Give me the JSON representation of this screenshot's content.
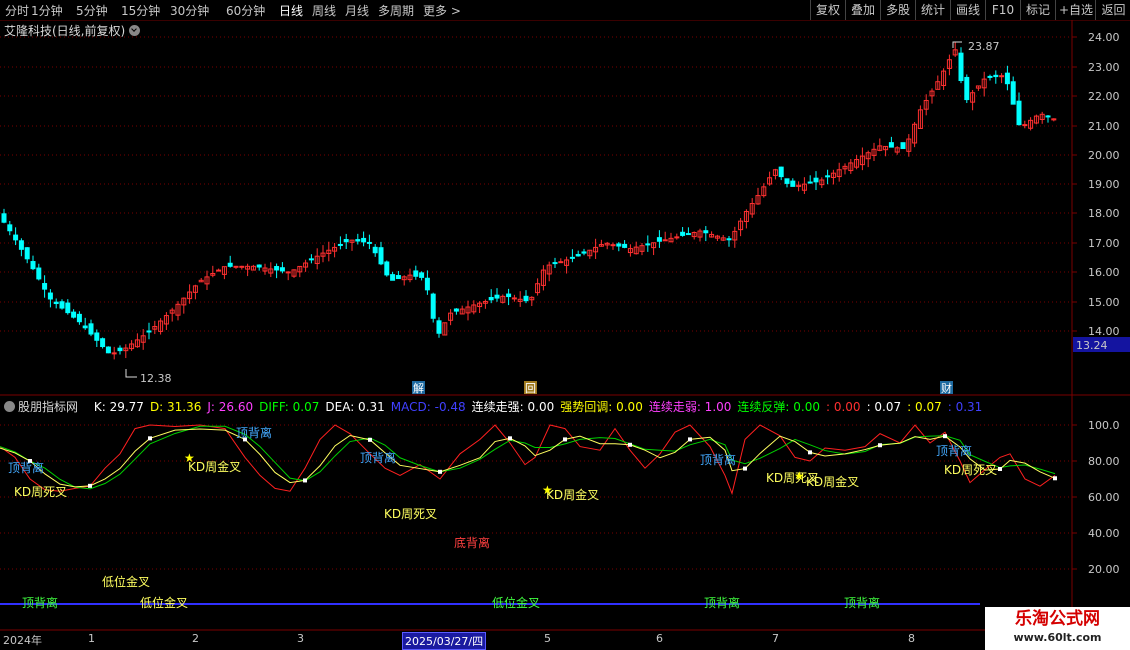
{
  "toolbar": {
    "periods": [
      "分时",
      "1分钟",
      "5分钟",
      "15分钟",
      "30分钟",
      "60分钟",
      "日线",
      "周线",
      "月线",
      "多周期",
      "更多 >"
    ],
    "active_period": "日线",
    "right_buttons": [
      "复权",
      "叠加",
      "多股",
      "统计",
      "画线",
      "F10",
      "标记",
      "+自选",
      "返回"
    ]
  },
  "stock": {
    "title": "艾隆科技(日线,前复权)"
  },
  "price_axis": {
    "ticks": [
      "24.00",
      "23.00",
      "22.00",
      "21.00",
      "20.00",
      "19.00",
      "18.00",
      "17.00",
      "16.00",
      "15.00",
      "14.00",
      "13.24"
    ],
    "current": "13.24"
  },
  "annotations": {
    "high": "23.87",
    "low": "12.38"
  },
  "markers": [
    "解",
    "回",
    "财"
  ],
  "indicator": {
    "name": "股朋指标网",
    "values": [
      {
        "label": "K: 29.77",
        "color": "#ffffff"
      },
      {
        "label": "D: 31.36",
        "color": "#ffff00"
      },
      {
        "label": "J: 26.60",
        "color": "#ff40ff"
      },
      {
        "label": "DIFF: 0.07",
        "color": "#00ff00"
      },
      {
        "label": "DEA: 0.31",
        "color": "#ffffff"
      },
      {
        "label": "MACD: -0.48",
        "color": "#4040ff"
      },
      {
        "label": "连续走强: 0.00",
        "color": "#ffffff"
      },
      {
        "label": "强势回调: 0.00",
        "color": "#ffff00"
      },
      {
        "label": "连续走弱: 1.00",
        "color": "#ff40ff"
      },
      {
        "label": "连续反弹: 0.00",
        "color": "#00ff00"
      },
      {
        "label": ": 0.00",
        "color": "#ff3030"
      },
      {
        "label": ": 0.07",
        "color": "#ffffff"
      },
      {
        "label": ": 0.07",
        "color": "#ffff00"
      },
      {
        "label": ": 0.31",
        "color": "#4040ff"
      }
    ],
    "axis": [
      "100.0",
      "80.00",
      "60.00",
      "40.00",
      "20.00"
    ],
    "labels": {
      "top_div": "顶背离",
      "bottom_div": "底背离",
      "kd_week_dead": "KD周死叉",
      "kd_week_gold": "KD周金叉",
      "low_gold": "低位金叉"
    }
  },
  "dates": [
    "2024年",
    "1",
    "2",
    "3",
    "2025/03/27/四",
    "5",
    "6",
    "7",
    "8"
  ],
  "watermark": {
    "line1": "乐淘公式网",
    "line2": "www.60lt.com"
  },
  "colors": {
    "up": "#ff3030",
    "down": "#00ffff",
    "grid": "#7a0000"
  }
}
